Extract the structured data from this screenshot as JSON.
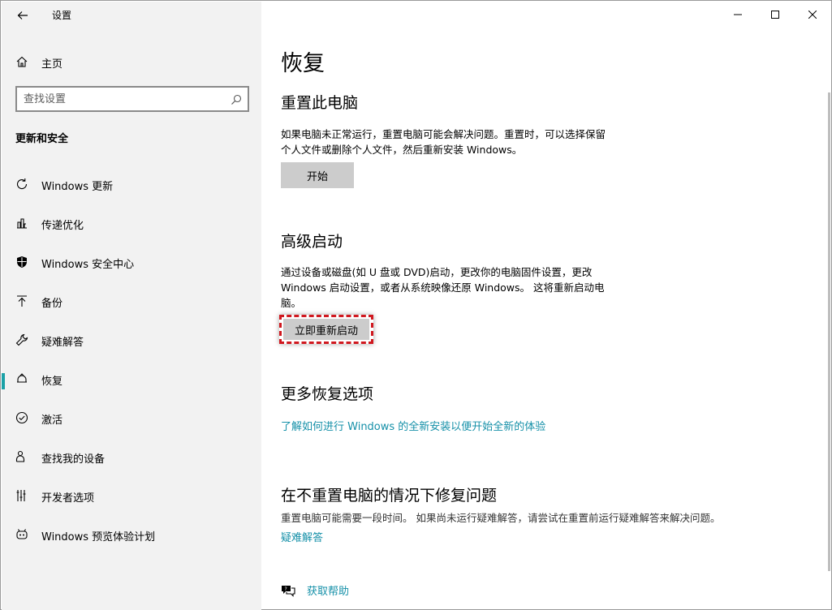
{
  "app": {
    "title": "设置"
  },
  "sidebar": {
    "home_label": "主页",
    "search_placeholder": "查找设置",
    "section_title": "更新和安全",
    "items": [
      {
        "label": "Windows 更新",
        "icon": "refresh-icon"
      },
      {
        "label": "传递优化",
        "icon": "delivery-icon"
      },
      {
        "label": "Windows 安全中心",
        "icon": "shield-icon"
      },
      {
        "label": "备份",
        "icon": "backup-icon"
      },
      {
        "label": "疑难解答",
        "icon": "wrench-icon"
      },
      {
        "label": "恢复",
        "icon": "recovery-icon",
        "active": true
      },
      {
        "label": "激活",
        "icon": "check-circle-icon"
      },
      {
        "label": "查找我的设备",
        "icon": "find-device-icon"
      },
      {
        "label": "开发者选项",
        "icon": "developer-icon"
      },
      {
        "label": "Windows 预览体验计划",
        "icon": "insider-icon"
      }
    ]
  },
  "main": {
    "page_title": "恢复",
    "reset": {
      "heading": "重置此电脑",
      "line1": "如果电脑未正常运行，重置电脑可能会解决问题。重置时，可以选择保留",
      "line2": "个人文件或删除个人文件，然后重新安装 Windows。",
      "button": "开始"
    },
    "advanced": {
      "heading": "高级启动",
      "line1": "通过设备或磁盘(如 U 盘或 DVD)启动，更改你的电脑固件设置，更改",
      "line2": "Windows 启动设置，或者从系统映像还原 Windows。 这将重新启动电",
      "line3": "脑。",
      "button": "立即重新启动"
    },
    "more": {
      "heading": "更多恢复选项",
      "link": "了解如何进行 Windows 的全新安装以便开始全新的体验"
    },
    "fix": {
      "heading": "在不重置电脑的情况下修复问题",
      "text": "重置电脑可能需要一段时间。 如果尚未运行疑难解答，请尝试在重置前运行疑难解答来解决问题。",
      "link": "疑难解答"
    },
    "help": {
      "label": "获取帮助"
    }
  },
  "colors": {
    "accent": "#1ba1a7",
    "link": "#1590a8",
    "highlight_border": "#d0181f"
  }
}
